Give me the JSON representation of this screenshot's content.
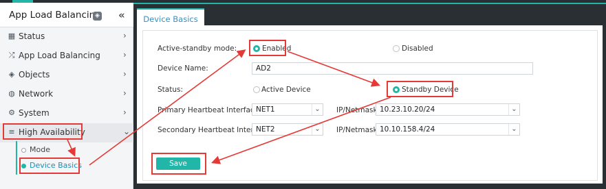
{
  "sidebar": {
    "title": "App Load Balancing",
    "items": [
      {
        "label": "Status",
        "icon": "grid-icon"
      },
      {
        "label": "App Load Balancing",
        "icon": "shuffle-icon"
      },
      {
        "label": "Objects",
        "icon": "layers-icon"
      },
      {
        "label": "Network",
        "icon": "globe-icon"
      },
      {
        "label": "System",
        "icon": "gear-icon"
      },
      {
        "label": "High Availability",
        "icon": "list-icon"
      }
    ],
    "subitems": [
      {
        "label": "Mode"
      },
      {
        "label": "Device Basics"
      }
    ]
  },
  "tab": {
    "label": "Device Basics"
  },
  "form": {
    "mode_label": "Active-standby mode:",
    "mode_enabled": "Enabled",
    "mode_disabled": "Disabled",
    "device_name_label": "Device Name:",
    "device_name_value": "AD2",
    "status_label": "Status:",
    "status_active": "Active Device",
    "status_standby": "Standby Device",
    "primary_label": "Primary Heartbeat Interface:",
    "primary_value": "NET1",
    "primary_ip_label": "IP/Netmask:",
    "primary_ip_value": "10.23.10.20/24",
    "secondary_label": "Secondary Heartbeat Interface:",
    "secondary_value": "NET2",
    "secondary_ip_label": "IP/Netmask:",
    "secondary_ip_value": "10.10.158.4/24",
    "save_label": "Save"
  },
  "colors": {
    "accent": "#21b6a8",
    "highlight": "#e53935",
    "dark": "#2a2f33"
  }
}
